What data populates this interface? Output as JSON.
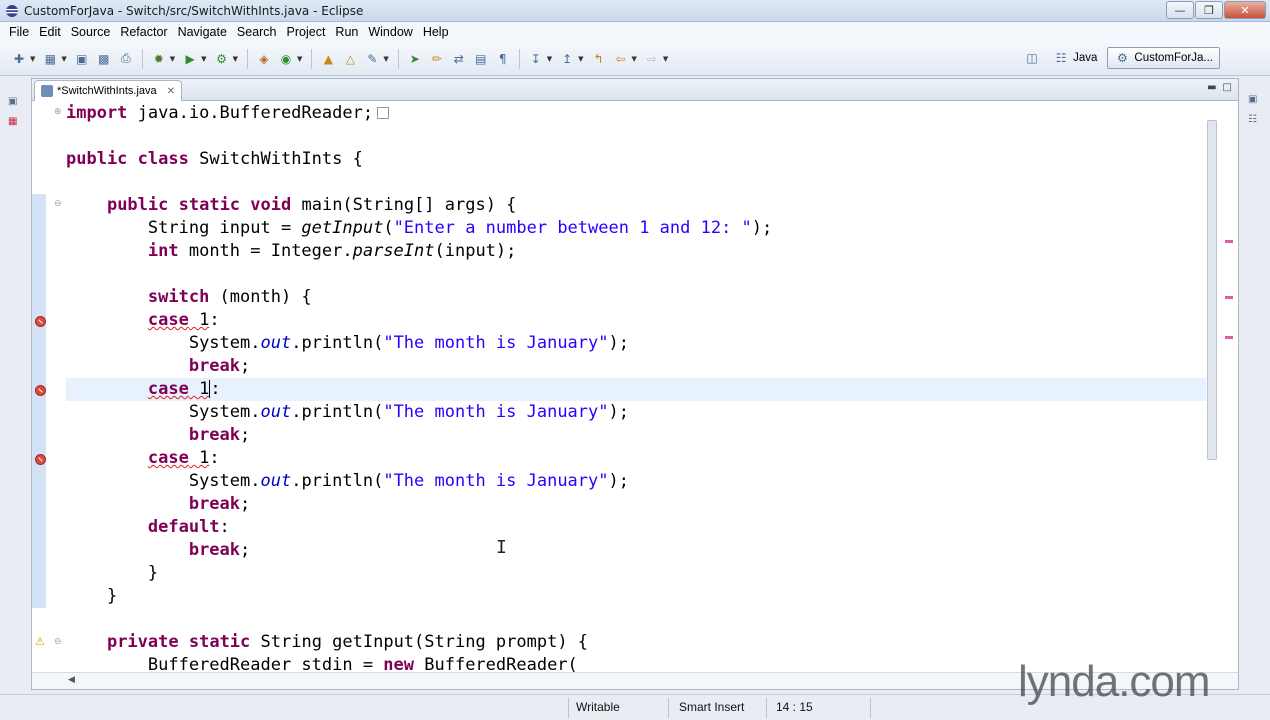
{
  "window": {
    "title": "CustomForJava - Switch/src/SwitchWithInts.java - Eclipse"
  },
  "menu": [
    "File",
    "Edit",
    "Source",
    "Refactor",
    "Navigate",
    "Search",
    "Project",
    "Run",
    "Window",
    "Help"
  ],
  "perspectives": {
    "java": "Java",
    "custom": "CustomForJa..."
  },
  "editor": {
    "tab_label": "*SwitchWithInts.java",
    "line_segments": [
      [
        [
          "kw",
          "import"
        ],
        [
          "",
          "java.io.BufferedReader;"
        ]
      ],
      [],
      [
        [
          "kw",
          "public"
        ],
        [
          "",
          ""
        ],
        [
          "kw",
          "class"
        ],
        [
          "",
          "SwitchWithInts {"
        ]
      ],
      [],
      [
        [
          "",
          "    "
        ],
        [
          "kw",
          "public"
        ],
        [
          "kw",
          "static"
        ],
        [
          "kw",
          "void"
        ],
        [
          "",
          "main(String[] args) {"
        ]
      ]
    ],
    "code": {
      "l1_import": "import",
      "l1_rest": " java.io.BufferedReader;",
      "l3_public": "public",
      "l3_class": "class",
      "l3_rest": " SwitchWithInts {",
      "l5_public": "public",
      "l5_static": "static",
      "l5_void": "void",
      "l5_rest": " main(String[] args) {",
      "l6_a": "String input = ",
      "l6_call": "getInput",
      "l6_b": "(",
      "l6_str": "\"Enter a number between 1 and 12: \"",
      "l6_c": ");",
      "l7_int": "int",
      "l7_a": " month = Integer.",
      "l7_call": "parseInt",
      "l7_b": "(input);",
      "l9_switch": "switch",
      "l9_rest": " (month) {",
      "case_kw": "case",
      "case_val": " 1",
      "case_colon": ":",
      "println_a": "System.",
      "println_out": "out",
      "println_b": ".println(",
      "println_str": "\"The month is January\"",
      "println_c": ");",
      "break_kw": "break",
      "semi": ";",
      "default_kw": "default",
      "close_brace": "}",
      "l26_private": "private",
      "l26_static": "static",
      "l26_rest": " String getInput(String prompt) {",
      "l27_a": "BufferedReader stdin = ",
      "l27_new": "new",
      "l27_b": " BufferedReader("
    }
  },
  "status": {
    "writable": "Writable",
    "insert_mode": "Smart Insert",
    "position": "14 : 15"
  },
  "watermark": "lynda.com"
}
